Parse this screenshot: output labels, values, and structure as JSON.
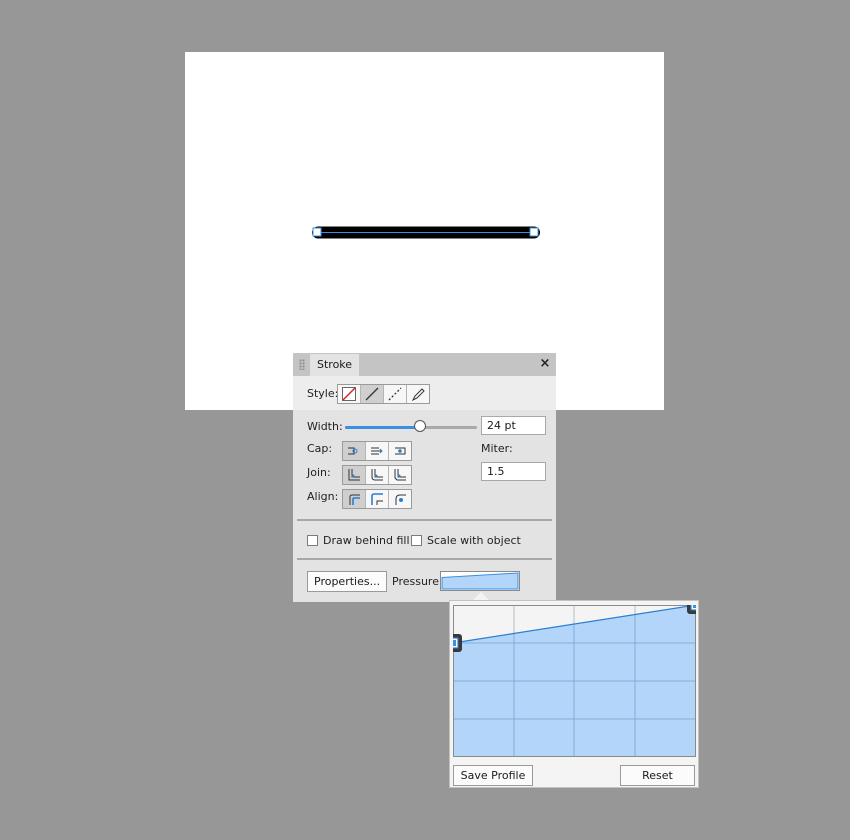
{
  "panel": {
    "tab_label": "Stroke",
    "close_glyph": "×",
    "style_label": "Style:",
    "style_buttons": [
      "no-stroke-icon",
      "solid-line-icon",
      "dashed-line-icon",
      "brush-stroke-icon"
    ],
    "width_label": "Width:",
    "width_value": "24 pt",
    "width_slider_fraction": 0.57,
    "cap_label": "Cap:",
    "join_label": "Join:",
    "align_label": "Align:",
    "miter_label": "Miter:",
    "miter_value": "1.5",
    "draw_behind_fill_label": "Draw behind fill",
    "draw_behind_fill_checked": false,
    "scale_with_object_label": "Scale with object",
    "scale_with_object_checked": false,
    "properties_label": "Properties...",
    "pressure_label": "Pressure:"
  },
  "pressure_popup": {
    "save_profile_label": "Save Profile",
    "reset_label": "Reset",
    "start_pressure": 0.75,
    "end_pressure": 1.0
  },
  "colors": {
    "accent": "#3b8fe0",
    "curve_fill": "#b2d5f9",
    "stroke": "#000000",
    "no_stroke_red": "#d32020"
  }
}
